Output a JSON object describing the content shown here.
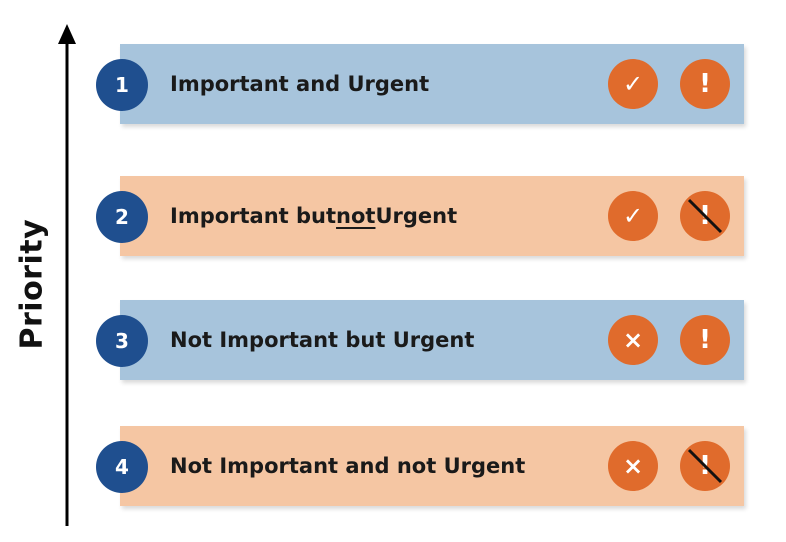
{
  "axis": {
    "label": "Priority"
  },
  "levels": [
    {
      "number": "1",
      "pre": "Important and Urgent",
      "underlined": "",
      "post": "",
      "important": "✓",
      "urgent": "!",
      "urgent_crossed": false
    },
    {
      "number": "2",
      "pre": "Important but ",
      "underlined": "not",
      "post": " Urgent",
      "important": "✓",
      "urgent": "!",
      "urgent_crossed": true
    },
    {
      "number": "3",
      "pre": "Not Important but Urgent",
      "underlined": "",
      "post": "",
      "important": "×",
      "urgent": "!",
      "urgent_crossed": false
    },
    {
      "number": "4",
      "pre": "Not Important and not Urgent",
      "underlined": "",
      "post": "",
      "important": "×",
      "urgent": "!",
      "urgent_crossed": true
    }
  ],
  "colors": {
    "blue_bar": "#a7c4dc",
    "orange_bar": "#f5c6a3",
    "circle": "#1f4f8f",
    "badge": "#e06b2c"
  }
}
